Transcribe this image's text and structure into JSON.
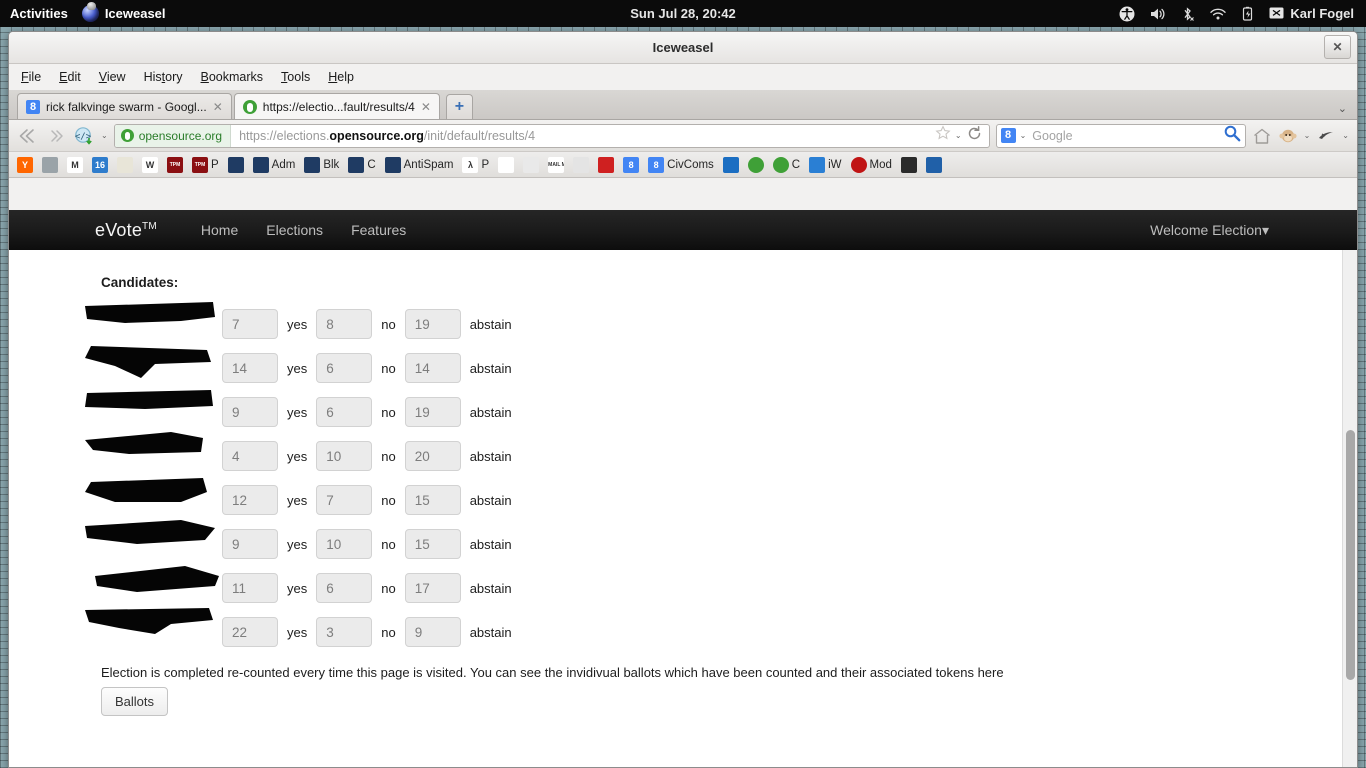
{
  "desktop": {
    "activities": "Activities",
    "app_name": "Iceweasel",
    "clock": "Sun Jul 28, 20:42",
    "user": "Karl Fogel",
    "tray_icons": [
      "accessibility-icon",
      "volume-icon",
      "bluetooth-disabled-icon",
      "wifi-icon",
      "battery-icon",
      "messages-icon"
    ]
  },
  "window": {
    "title": "Iceweasel",
    "close_label": "✕"
  },
  "menubar": [
    {
      "pre": "",
      "key": "F",
      "post": "ile"
    },
    {
      "pre": "",
      "key": "E",
      "post": "dit"
    },
    {
      "pre": "",
      "key": "V",
      "post": "iew"
    },
    {
      "pre": "His",
      "key": "t",
      "post": "ory"
    },
    {
      "pre": "",
      "key": "B",
      "post": "ookmarks"
    },
    {
      "pre": "",
      "key": "T",
      "post": "ools"
    },
    {
      "pre": "",
      "key": "H",
      "post": "elp"
    }
  ],
  "tabs": [
    {
      "label": "rick falkvinge swarm - Googl...",
      "favicon": "google-favicon",
      "active": false,
      "close": "✕"
    },
    {
      "label": "https://electio...fault/results/4",
      "favicon": "opensource-favicon",
      "active": true,
      "close": "✕"
    }
  ],
  "newtab_label": "+",
  "toolbar": {
    "back_icon": "back-arrow-icon",
    "forward_icon": "forward-arrow-icon",
    "reader_icon": "view-source-icon",
    "identity_label": "opensource.org",
    "url_prefix": "https://elections.",
    "url_domain": "opensource.org",
    "url_suffix": "/init/default/results/4",
    "bookmark_icon": "star-icon",
    "reload_icon": "reload-icon",
    "search_engine": "Google",
    "search_value": "",
    "search_placeholder": "Google",
    "search_icon": "magnifier-icon",
    "home_icon": "home-icon",
    "monkey_icon": "monkey-icon",
    "addon_icon": "addon-icon"
  },
  "bookmarks": [
    {
      "label": "",
      "icon": "yahoo-icon",
      "color": "#ff6600",
      "text": "Y"
    },
    {
      "label": "",
      "icon": "grey-square-icon",
      "color": "#9aa3a8",
      "text": ""
    },
    {
      "label": "",
      "icon": "gmail-icon",
      "color": "#ffffff",
      "text": "M"
    },
    {
      "label": "",
      "icon": "calendar-icon",
      "color": "#2e7ccc",
      "text": "16"
    },
    {
      "label": "",
      "icon": "maps-icon",
      "color": "#e8e5d8",
      "text": ""
    },
    {
      "label": "",
      "icon": "wikipedia-icon",
      "color": "#ffffff",
      "text": "W"
    },
    {
      "label": "",
      "icon": "tpm-icon",
      "color": "#8b0f12",
      "text": "TPM"
    },
    {
      "label": "P",
      "icon": "tpm-icon",
      "color": "#8b0f12",
      "text": "TPM"
    },
    {
      "label": "",
      "icon": "civicrm-icon",
      "color": "#1f3b63",
      "text": ""
    },
    {
      "label": "Adm",
      "icon": "civicrm-icon",
      "color": "#1f3b63",
      "text": ""
    },
    {
      "label": "Blk",
      "icon": "civicrm-icon",
      "color": "#1f3b63",
      "text": ""
    },
    {
      "label": "C",
      "icon": "civicrm-icon",
      "color": "#1f3b63",
      "text": ""
    },
    {
      "label": "AntiSpam",
      "icon": "civicrm-icon",
      "color": "#1f3b63",
      "text": ""
    },
    {
      "label": "P",
      "icon": "lambda-icon",
      "color": "#ffffff",
      "text": "λ"
    },
    {
      "label": "",
      "icon": "colorful-icon",
      "color": "#ffffff",
      "text": ""
    },
    {
      "label": "",
      "icon": "clip-icon",
      "color": "#e9e9e9",
      "text": ""
    },
    {
      "label": "",
      "icon": "mailman-icon",
      "color": "#ffffff",
      "text": "MAIL MAN"
    },
    {
      "label": "",
      "icon": "gnu-icon",
      "color": "#e4e4e4",
      "text": ""
    },
    {
      "label": "",
      "icon": "red-book-icon",
      "color": "#cf2020",
      "text": ""
    },
    {
      "label": "",
      "icon": "google-icon",
      "color": "#4285f4",
      "text": "8"
    },
    {
      "label": "CivComs",
      "icon": "google-icon",
      "color": "#4285f4",
      "text": "8"
    },
    {
      "label": "",
      "icon": "blue-diamond-icon",
      "color": "#1b6ec2",
      "text": ""
    },
    {
      "label": "",
      "icon": "opensource-icon",
      "color": "#3fa037",
      "text": ""
    },
    {
      "label": "C",
      "icon": "opensource-icon",
      "color": "#3fa037",
      "text": ""
    },
    {
      "label": "iW",
      "icon": "iw-icon",
      "color": "#2a7fd4",
      "text": ""
    },
    {
      "label": "Mod",
      "icon": "red-ball-icon",
      "color": "#c01414",
      "text": ""
    },
    {
      "label": "",
      "icon": "burger-icon",
      "color": "#2b2b2b",
      "text": ""
    },
    {
      "label": "",
      "icon": "blue-arch-icon",
      "color": "#2060a8",
      "text": ""
    }
  ],
  "site": {
    "brand": "eVote",
    "brand_tm": "TM",
    "nav": [
      "Home",
      "Elections",
      "Features"
    ],
    "welcome": "Welcome Election",
    "welcome_caret": "▾"
  },
  "results": {
    "candidates_heading": "Candidates:",
    "label_yes": "yes",
    "label_no": "no",
    "label_abstain": "abstain",
    "rows": [
      {
        "name": "[redacted]",
        "yes": "7",
        "no": "8",
        "abstain": "19"
      },
      {
        "name": "[redacted]",
        "yes": "14",
        "no": "6",
        "abstain": "14"
      },
      {
        "name": "[redacted]",
        "yes": "9",
        "no": "6",
        "abstain": "19"
      },
      {
        "name": "[redacted]",
        "yes": "4",
        "no": "10",
        "abstain": "20"
      },
      {
        "name": "[redacted]",
        "yes": "12",
        "no": "7",
        "abstain": "15"
      },
      {
        "name": "[redacted]",
        "yes": "9",
        "no": "10",
        "abstain": "15"
      },
      {
        "name": "[redacted]",
        "yes": "11",
        "no": "6",
        "abstain": "17"
      },
      {
        "name": "[redacted]",
        "yes": "22",
        "no": "3",
        "abstain": "9"
      }
    ],
    "note": "Election is completed re-counted every time this page is visited. You can see the invidivual ballots which have been counted and their associated tokens here",
    "ballots_button": "Ballots"
  },
  "colors": {
    "navbar_bg": "#1a1a1a",
    "identity_green": "#3fa037",
    "google_blue": "#4285f4",
    "field_bg": "#ebebeb"
  }
}
